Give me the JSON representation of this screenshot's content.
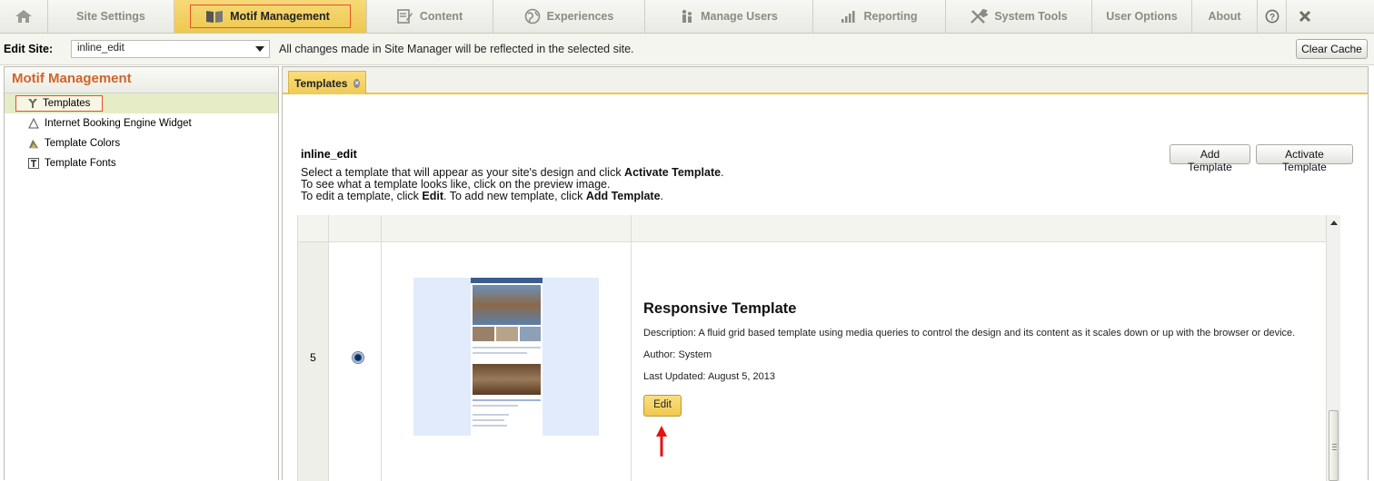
{
  "nav": {
    "items": [
      {
        "label": "",
        "icon": "home-icon"
      },
      {
        "label": "Site Settings"
      },
      {
        "label": "Motif Management",
        "icon": "book-icon"
      },
      {
        "label": "Content",
        "icon": "content-icon"
      },
      {
        "label": "Experiences",
        "icon": "globe-icon"
      },
      {
        "label": "Manage Users",
        "icon": "users-icon"
      },
      {
        "label": "Reporting",
        "icon": "chart-icon"
      },
      {
        "label": "System Tools",
        "icon": "tools-icon"
      },
      {
        "label": "User Options"
      },
      {
        "label": "About"
      },
      {
        "label": "",
        "icon": "help-icon"
      },
      {
        "label": "",
        "icon": "close-icon"
      }
    ],
    "active_color": "#efc84f"
  },
  "sitebar": {
    "label": "Edit Site:",
    "selected_site": "inline_edit",
    "note": "All changes made in Site Manager will be reflected in the selected site.",
    "clear_cache": "Clear Cache"
  },
  "left_panel": {
    "title": "Motif Management",
    "items": [
      {
        "label": "Templates",
        "icon": "templates-icon"
      },
      {
        "label": "Internet Booking Engine Widget",
        "icon": "triangle-icon"
      },
      {
        "label": "Template Colors",
        "icon": "palette-icon"
      },
      {
        "label": "Template Fonts",
        "icon": "font-icon"
      }
    ]
  },
  "tab": {
    "label": "Templates"
  },
  "content": {
    "site_name": "inline_edit",
    "line1_a": "Select a template that will appear as your site's design and click ",
    "line1_b": "Activate Template",
    "line1_c": ".",
    "line2": "To see what a template looks like, click on the preview image.",
    "line3_a": "To edit a template, click ",
    "line3_b": "Edit",
    "line3_c": ". To add new template, click ",
    "line3_d": "Add Template",
    "line3_e": ".",
    "add_template": "Add Template",
    "activate_template": "Activate Template"
  },
  "template_row": {
    "number": "5",
    "name": "Responsive Template",
    "description": "Description: A fluid grid based template using media queries to control the design and its content as it scales down or up with the browser or device.",
    "author": "Author: System",
    "last_updated": "Last Updated: August 5, 2013",
    "edit": "Edit"
  }
}
